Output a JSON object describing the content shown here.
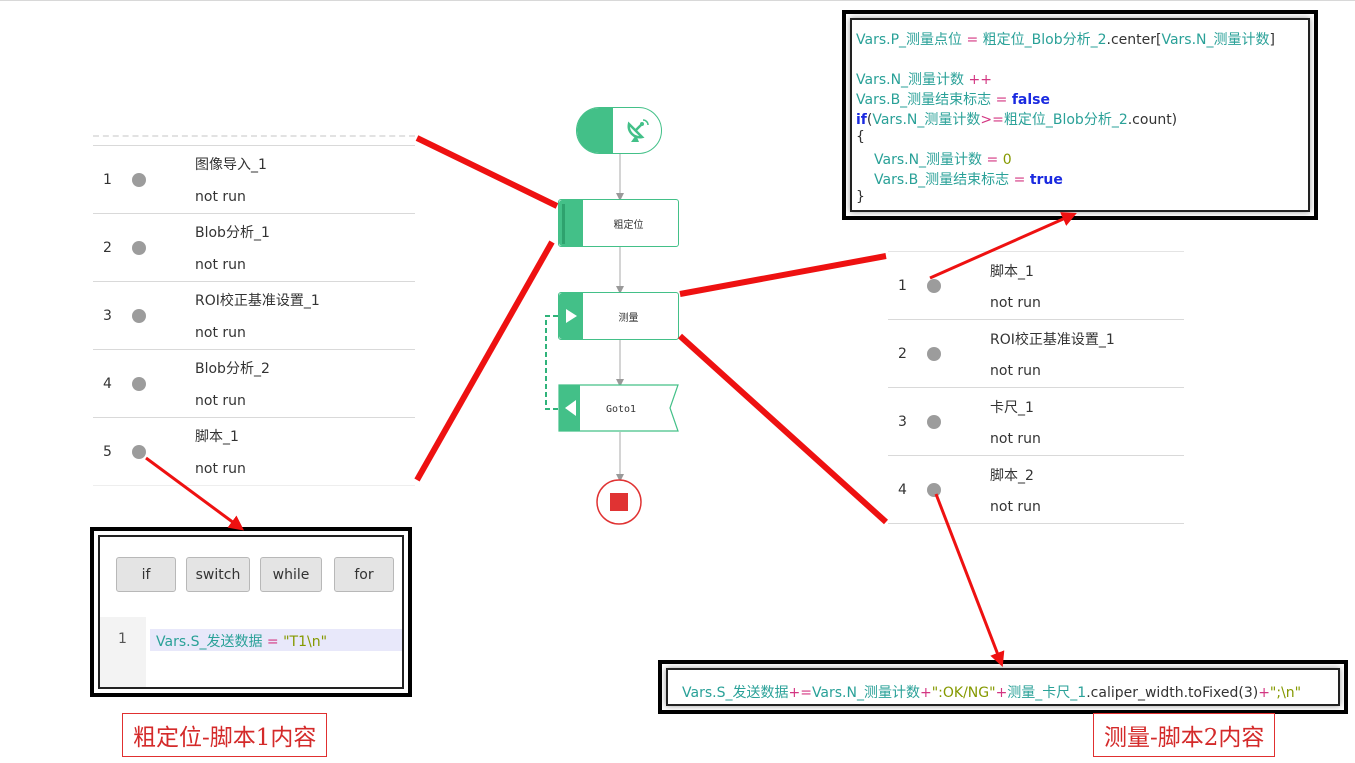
{
  "left_list": {
    "items": [
      {
        "num": "1",
        "name": "图像导入_1",
        "status": "not run"
      },
      {
        "num": "2",
        "name": "Blob分析_1",
        "status": "not run"
      },
      {
        "num": "3",
        "name": "ROI校正基准设置_1",
        "status": "not run"
      },
      {
        "num": "4",
        "name": "Blob分析_2",
        "status": "not run"
      },
      {
        "num": "5",
        "name": "脚本_1",
        "status": "not run"
      }
    ]
  },
  "right_list": {
    "items": [
      {
        "num": "1",
        "name": "脚本_1",
        "status": "not run"
      },
      {
        "num": "2",
        "name": "ROI校正基准设置_1",
        "status": "not run"
      },
      {
        "num": "3",
        "name": "卡尺_1",
        "status": "not run"
      },
      {
        "num": "4",
        "name": "脚本_2",
        "status": "not run"
      }
    ]
  },
  "flow": {
    "coarse_label": "粗定位",
    "measure_label": "测量",
    "goto_label": "Goto1"
  },
  "script_buttons": [
    "if",
    "switch",
    "while",
    "for"
  ],
  "script1": {
    "line_number": "1",
    "var": "Vars.S_发送数据",
    "op": " = ",
    "value": "\"T1\\n\""
  },
  "script_top": {
    "l1_var": "Vars.P_测量点位",
    "l1_op": " = ",
    "l1_ref": "粗定位_Blob分析_2",
    "l1_mid": ".center[",
    "l1_var2": "Vars.N_测量计数",
    "l1_end": "]",
    "l2_var": "Vars.N_测量计数",
    "l2_op": " ++",
    "l3_var": "Vars.B_测量结束标志",
    "l3_op": " = ",
    "l3_val": "false",
    "l4_kw": "if",
    "l4_open": "(",
    "l4_var": "Vars.N_测量计数",
    "l4_op": ">=",
    "l4_ref": "粗定位_Blob分析_2",
    "l4_end": ".count)",
    "l5": "{",
    "l6_var": "Vars.N_测量计数",
    "l6_op": " = ",
    "l6_val": "0",
    "l7_var": "Vars.B_测量结束标志",
    "l7_op": " = ",
    "l7_val": "true",
    "l8": "}"
  },
  "script2": {
    "a": "Vars.S_发送数据",
    "b": "+=",
    "c": "Vars.N_测量计数",
    "d": "+",
    "e": "\":OK/NG\"",
    "f": "+",
    "g": "测量_卡尺_1",
    "h": ".caliper_width.toFixed(3)",
    "i": "+",
    "j": "\";\\n\""
  },
  "captions": {
    "left": "粗定位-脚本1内容",
    "right": "测量-脚本2内容"
  },
  "colors": {
    "accent": "#43c088",
    "arrow": "#ee1111",
    "stop": "#e03333"
  }
}
